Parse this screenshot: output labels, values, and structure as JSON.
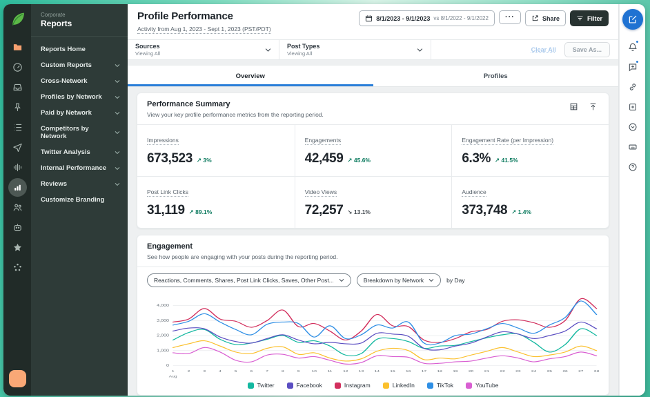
{
  "appearance": {
    "accent_blue": "#2b7fd9",
    "positive_green": "#0b7a5e",
    "negative_neutral": "#454c52",
    "active_icon_orange": "#f5a06f",
    "sidebar_bg": "#212b28",
    "sidebar_panel_bg": "#2e3b38",
    "top_backdrop_teal": "#2fbd9d"
  },
  "left_rail_icons": [
    "sprout-logo",
    "folder",
    "dashboard",
    "inbox",
    "pin",
    "feed",
    "publish",
    "listening",
    "reports",
    "people",
    "bot",
    "star",
    "apps",
    "avatar"
  ],
  "right_rail_icons": [
    "compose",
    "notifications",
    "messages",
    "link",
    "new-item",
    "updates",
    "keyboard-shortcuts",
    "help"
  ],
  "sidebar": {
    "workspace_label": "Corporate",
    "workspace_name": "Reports",
    "items": [
      {
        "label": "Reports Home",
        "chevron": false
      },
      {
        "label": "Custom Reports",
        "chevron": true
      },
      {
        "label": "Cross-Network",
        "chevron": true
      },
      {
        "label": "Profiles by Network",
        "chevron": true
      },
      {
        "label": "Paid by Network",
        "chevron": true
      },
      {
        "label": "Competitors by Network",
        "chevron": true
      },
      {
        "label": "Twitter Analysis",
        "chevron": true
      },
      {
        "label": "Internal Performance",
        "chevron": true
      },
      {
        "label": "Reviews",
        "chevron": true
      },
      {
        "label": "Customize Branding",
        "chevron": false
      }
    ]
  },
  "header": {
    "title": "Profile Performance",
    "subtitle": "Activity from Aug 1, 2023 - Sept 1, 2023 (PST/PDT)",
    "date_range": "8/1/2023 - 9/1/2023",
    "date_compare": "vs 8/1/2022 - 9/1/2022",
    "more_label": "···",
    "share_label": "Share",
    "filter_label": "Filter",
    "clear_all_label": "Clear All",
    "save_as_label": "Save As...",
    "filters": [
      {
        "label": "Sources",
        "value": "Viewing All"
      },
      {
        "label": "Post Types",
        "value": "Viewing All"
      }
    ],
    "tabs": [
      {
        "label": "Overview",
        "active": true
      },
      {
        "label": "Profiles",
        "active": false
      }
    ]
  },
  "performance_summary": {
    "title": "Performance Summary",
    "subtitle": "View your key profile performance metrics from the reporting period.",
    "metrics": [
      {
        "label": "Impressions",
        "value": "673,523",
        "delta": "3%",
        "direction": "up"
      },
      {
        "label": "Engagements",
        "value": "42,459",
        "delta": "45.6%",
        "direction": "up"
      },
      {
        "label": "Engagement Rate (per Impression)",
        "value": "6.3%",
        "delta": "41.5%",
        "direction": "up"
      },
      {
        "label": "Post Link Clicks",
        "value": "31,119",
        "delta": "89.1%",
        "direction": "up"
      },
      {
        "label": "Video Views",
        "value": "72,257",
        "delta": "13.1%",
        "direction": "down"
      },
      {
        "label": "Audience",
        "value": "373,748",
        "delta": "1.4%",
        "direction": "up"
      }
    ]
  },
  "engagement": {
    "title": "Engagement",
    "subtitle": "See how people are engaging with your posts during the reporting period.",
    "metric_select": "Reactions, Comments, Shares, Post Link Clicks, Saves, Other Post...",
    "breakdown_select": "Breakdown by Network",
    "granularity": "by Day"
  },
  "chart_data": {
    "type": "line",
    "x": [
      1,
      2,
      3,
      4,
      5,
      6,
      7,
      8,
      9,
      10,
      11,
      12,
      13,
      14,
      15,
      16,
      17,
      18,
      19,
      20,
      21,
      22,
      23,
      24,
      25,
      26,
      27,
      28
    ],
    "x_month_label": "Aug",
    "yticks": [
      0,
      1000,
      2000,
      3000,
      4000
    ],
    "ylim": [
      0,
      4600
    ],
    "grid": true,
    "legend_position": "bottom",
    "series": [
      {
        "name": "Twitter",
        "color": "#14b8a0",
        "values": [
          1700,
          2200,
          2400,
          1750,
          1400,
          1500,
          1750,
          2000,
          1550,
          1650,
          1300,
          700,
          800,
          1750,
          1800,
          1600,
          1150,
          1300,
          1350,
          1600,
          1850,
          2050,
          2100,
          1550,
          900,
          1400,
          2450,
          2000
        ]
      },
      {
        "name": "Facebook",
        "color": "#5b4ec2",
        "values": [
          2300,
          2500,
          2450,
          1900,
          1600,
          1500,
          1800,
          2050,
          1700,
          1450,
          1550,
          1450,
          1500,
          2150,
          2100,
          1950,
          1150,
          1050,
          1300,
          1500,
          1900,
          2250,
          2100,
          1800,
          2000,
          2300,
          2900,
          2450
        ]
      },
      {
        "name": "Instagram",
        "color": "#d22f5d",
        "values": [
          2900,
          3100,
          3800,
          3100,
          2950,
          2550,
          3000,
          3700,
          2600,
          2800,
          2300,
          1700,
          2300,
          3400,
          2650,
          2600,
          1700,
          1550,
          1800,
          2250,
          2400,
          2950,
          3050,
          2850,
          2550,
          3000,
          4450,
          3800
        ]
      },
      {
        "name": "LinkedIn",
        "color": "#fbc02d",
        "values": [
          1200,
          1450,
          1650,
          1300,
          900,
          800,
          1150,
          1250,
          750,
          850,
          500,
          300,
          450,
          950,
          1150,
          1000,
          400,
          500,
          450,
          700,
          950,
          1200,
          900,
          600,
          700,
          900,
          1300,
          1000
        ]
      },
      {
        "name": "TikTok",
        "color": "#2f8fe5",
        "values": [
          2700,
          2950,
          3450,
          2900,
          2400,
          2050,
          2750,
          2900,
          2800,
          1900,
          2650,
          1800,
          2050,
          2700,
          2500,
          2900,
          1500,
          1500,
          2000,
          2100,
          2450,
          2800,
          2500,
          2150,
          2700,
          3200,
          4300,
          3400
        ]
      },
      {
        "name": "YouTube",
        "color": "#d95fd2",
        "values": [
          850,
          800,
          1200,
          900,
          350,
          250,
          700,
          750,
          500,
          600,
          350,
          100,
          200,
          650,
          600,
          550,
          150,
          150,
          250,
          300,
          500,
          650,
          500,
          250,
          450,
          600,
          900,
          650
        ]
      }
    ]
  }
}
